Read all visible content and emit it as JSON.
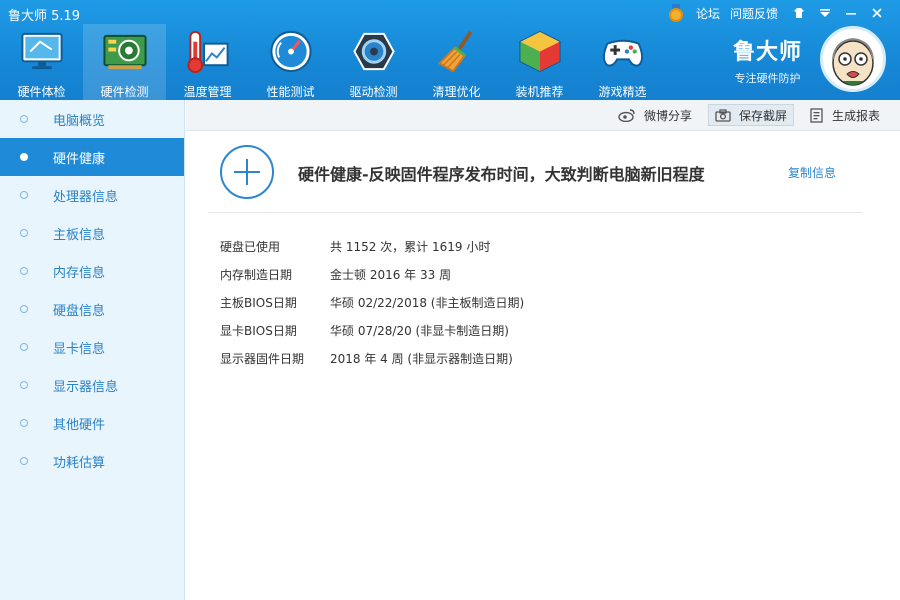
{
  "app": {
    "title": "鲁大师 5.19"
  },
  "top_links": {
    "forum": "论坛",
    "feedback": "问题反馈"
  },
  "nav": [
    {
      "label": "硬件体检",
      "icon": "monitor-check-icon"
    },
    {
      "label": "硬件检测",
      "icon": "hardware-board-icon"
    },
    {
      "label": "温度管理",
      "icon": "thermometer-icon"
    },
    {
      "label": "性能测试",
      "icon": "speedometer-icon"
    },
    {
      "label": "驱动检测",
      "icon": "gear-driver-icon"
    },
    {
      "label": "清理优化",
      "icon": "broom-icon"
    },
    {
      "label": "装机推荐",
      "icon": "cube-icon"
    },
    {
      "label": "游戏精选",
      "icon": "gamepad-icon"
    }
  ],
  "brand": {
    "name": "鲁大师",
    "slogan": "专注硬件防护"
  },
  "sidebar": {
    "items": [
      {
        "label": "电脑概览"
      },
      {
        "label": "硬件健康"
      },
      {
        "label": "处理器信息"
      },
      {
        "label": "主板信息"
      },
      {
        "label": "内存信息"
      },
      {
        "label": "硬盘信息"
      },
      {
        "label": "显卡信息"
      },
      {
        "label": "显示器信息"
      },
      {
        "label": "其他硬件"
      },
      {
        "label": "功耗估算"
      }
    ]
  },
  "toolbar": {
    "weibo_share": "微博分享",
    "save_screenshot": "保存截屏",
    "generate_report": "生成报表"
  },
  "main": {
    "title": "硬件健康-反映固件程序发布时间，大致判断电脑新旧程度",
    "copy_info": "复制信息",
    "rows": [
      {
        "label": "硬盘已使用",
        "value": "共 1152 次，累计 1619 小时"
      },
      {
        "label": "内存制造日期",
        "value": "金士顿 2016 年 33 周"
      },
      {
        "label": "主板BIOS日期",
        "value": "华硕 02/22/2018 (非主板制造日期)"
      },
      {
        "label": "显卡BIOS日期",
        "value": "华硕 07/28/20 (非显卡制造日期)"
      },
      {
        "label": "显示器固件日期",
        "value": "2018 年 4 周 (非显示器制造日期)"
      }
    ]
  }
}
